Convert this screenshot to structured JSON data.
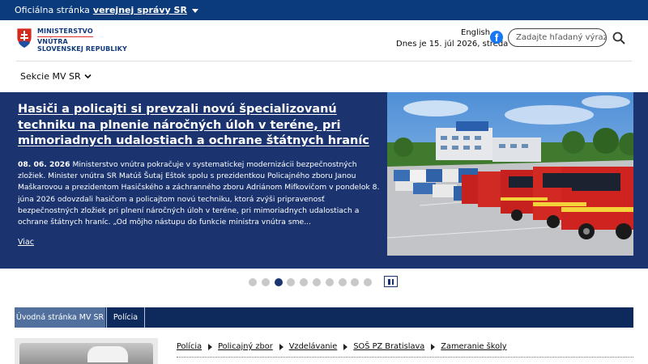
{
  "govbar": {
    "prefix": "Oficiálna stránka",
    "link": "verejnej správy SR"
  },
  "header": {
    "logo_line1": "MINISTERSTVO",
    "logo_line2": "VNÚTRA",
    "logo_line3": "SLOVENSKEJ REPUBLIKY",
    "lang": "English",
    "date": "Dnes je 15. júl 2026, streda",
    "search_placeholder": "Zadajte hľadaný výraz",
    "section_menu": "Sekcie MV SR"
  },
  "hero": {
    "title": "Hasiči a policajti si prevzali novú špecializovanú techniku na plnenie náročných úloh v teréne, pri mimoriadnych udalostiach a ochrane štátnych hraníc",
    "date": "08. 06. 2026",
    "body": " Ministerstvo vnútra pokračuje v systematickej modernizácii bezpečnostných zložiek. Minister vnútra SR Matúš Šutaj Eštok spolu s prezidentkou Policajného zboru Janou Maškarovou a prezidentom Hasičského a záchranného zboru Adriánom Mifkovičom v pondelok 8. júna 2026 odovzdali hasičom a policajtom novú techniku, ktorá zvýši pripravenosť bezpečnostných zložiek pri plnení náročných úloh v teréne, pri mimoriadnych udalostiach a ochrane štátnych hraníc. „Od môjho nástupu do funkcie ministra vnútra sme...",
    "more": "Viac",
    "slides_total": 10,
    "active_slide": 3
  },
  "tabs": [
    {
      "label": "Úvodná stránka MV SR"
    },
    {
      "label": "Polícia"
    }
  ],
  "breadcrumb": [
    "Polícia",
    "Policajný zbor",
    "Vzdelávanie",
    "SOŠ PZ Bratislava",
    "Zameranie školy"
  ],
  "icons": {
    "facebook": "facebook-icon",
    "search": "search-icon",
    "pause": "pause-icon"
  }
}
